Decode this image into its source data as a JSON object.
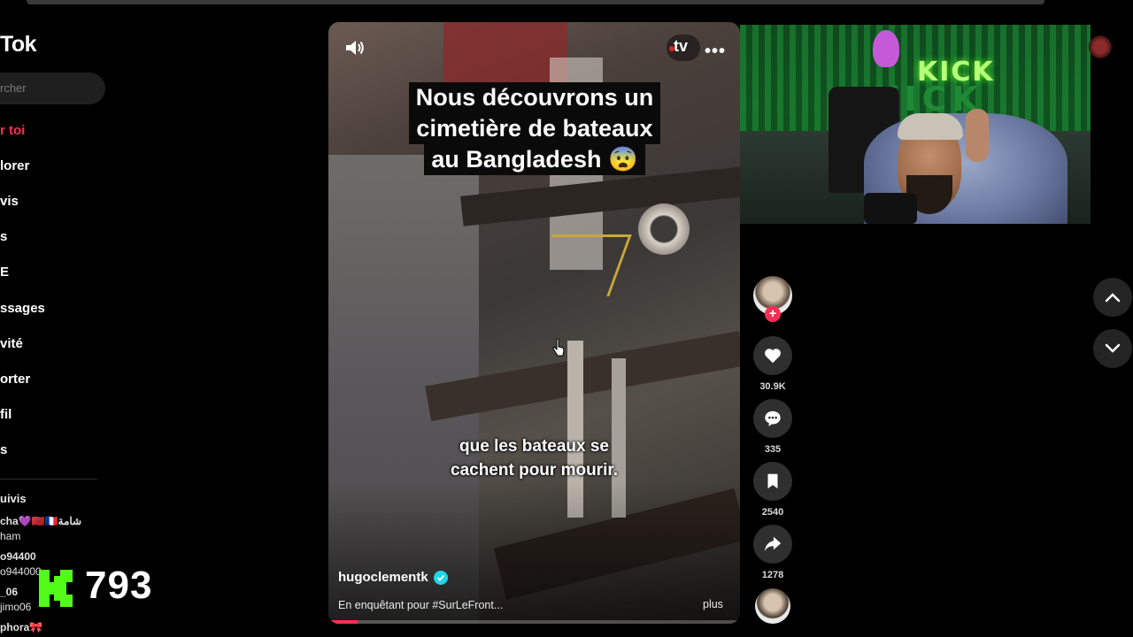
{
  "sidebar": {
    "logo": "Tok",
    "search_placeholder": "rcher",
    "nav": [
      {
        "label": "r toi",
        "active": true
      },
      {
        "label": "lorer"
      },
      {
        "label": "vis"
      },
      {
        "label": "s"
      },
      {
        "label": "E"
      },
      {
        "label": "ssages"
      },
      {
        "label": "vité"
      },
      {
        "label": "orter"
      },
      {
        "label": "fil"
      },
      {
        "label": "s"
      }
    ],
    "following_title": "uivis",
    "following": [
      "cha💜🇲🇦🇫🇷شامة",
      "ham",
      "o94400",
      "o944000",
      "_06",
      "jimo06",
      "phora🎀"
    ]
  },
  "kick_overlay": {
    "viewer_count": "793",
    "brand_color": "#53fc18"
  },
  "video": {
    "channel_badge": "tv",
    "caption_lines": [
      "Nous découvrons un",
      "cimetière de bateaux",
      "au Bangladesh 😨"
    ],
    "subtitle_lines": [
      "que les bateaux se",
      "cachent pour mourir."
    ],
    "author": "hugoclementk",
    "description": "En enquêtant pour #SurLeFront...",
    "more_label": "plus",
    "progress": 0.07
  },
  "actions": {
    "likes": "30.9K",
    "comments": "335",
    "bookmarks": "2540",
    "shares": "1278"
  },
  "webcam": {
    "sign_text": "KICK",
    "sign_text_large": "KICK"
  },
  "colors": {
    "accent": "#fe2c55",
    "verified": "#20d5ec"
  },
  "icons": {
    "volume": "volume-icon",
    "more": "more-icon",
    "heart": "heart-icon",
    "comment": "comment-icon",
    "bookmark": "bookmark-icon",
    "share": "share-icon",
    "up": "chevron-up-icon",
    "down": "chevron-down-icon"
  }
}
